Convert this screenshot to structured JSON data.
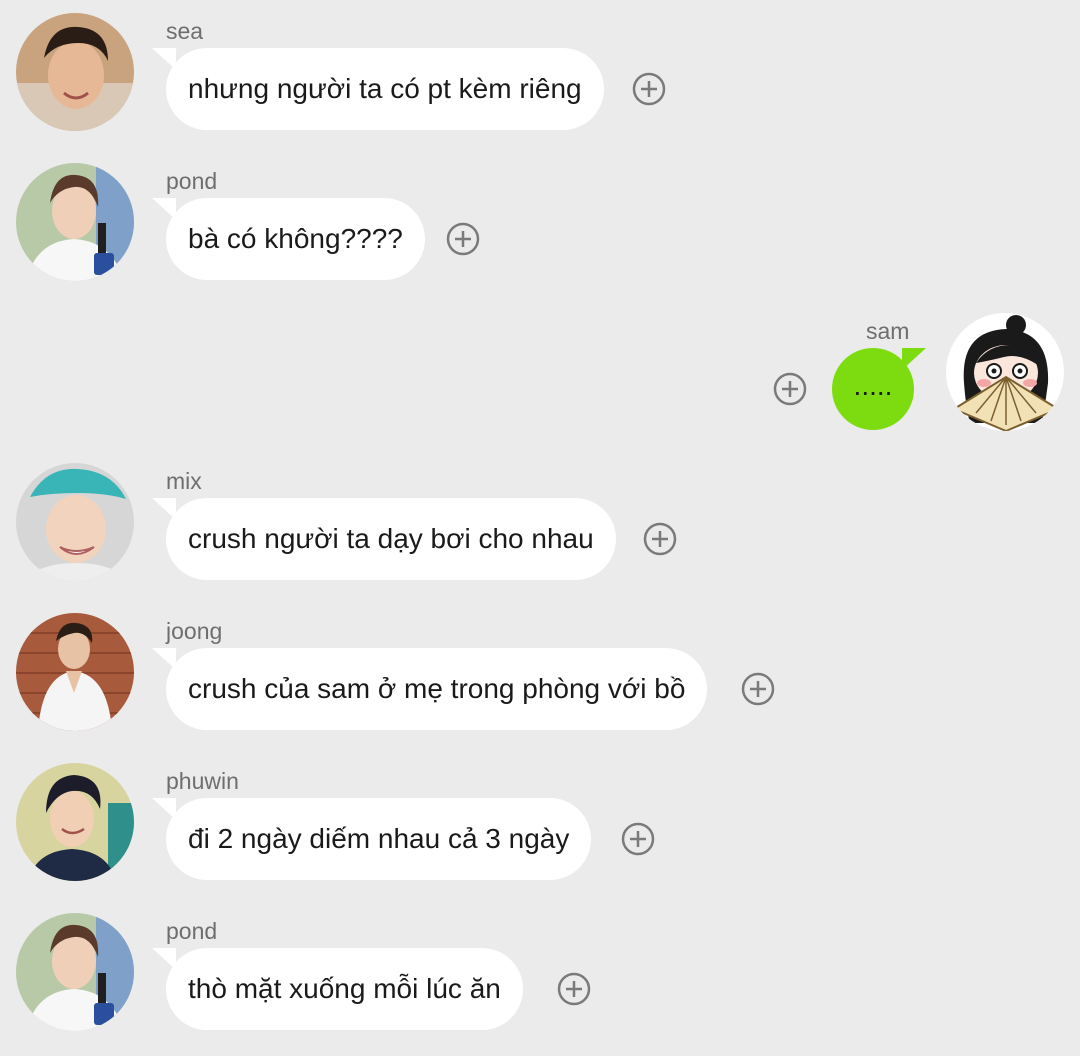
{
  "messages": [
    {
      "sender": "sea",
      "text": "nhưng người ta có pt kèm riêng",
      "side": "in"
    },
    {
      "sender": "pond",
      "text": "bà có không????",
      "side": "in"
    },
    {
      "sender": "sam",
      "text": ".....",
      "side": "out"
    },
    {
      "sender": "mix",
      "text": "crush người ta dạy bơi cho nhau",
      "side": "in"
    },
    {
      "sender": "joong",
      "text": "crush của sam ở mẹ trong phòng với bồ",
      "side": "in"
    },
    {
      "sender": "phuwin",
      "text": "đi 2 ngày diếm nhau cả 3 ngày",
      "side": "in"
    },
    {
      "sender": "pond",
      "text": "thò mặt xuống mỗi lúc ăn",
      "side": "in"
    }
  ],
  "colors": {
    "background": "#ebebeb",
    "incoming_bubble": "#ffffff",
    "outgoing_bubble": "#7ddc10",
    "sender_name": "#6e6e6e",
    "icon_stroke": "#7a7a7a"
  },
  "icons": {
    "reaction": "add-circle-icon"
  }
}
